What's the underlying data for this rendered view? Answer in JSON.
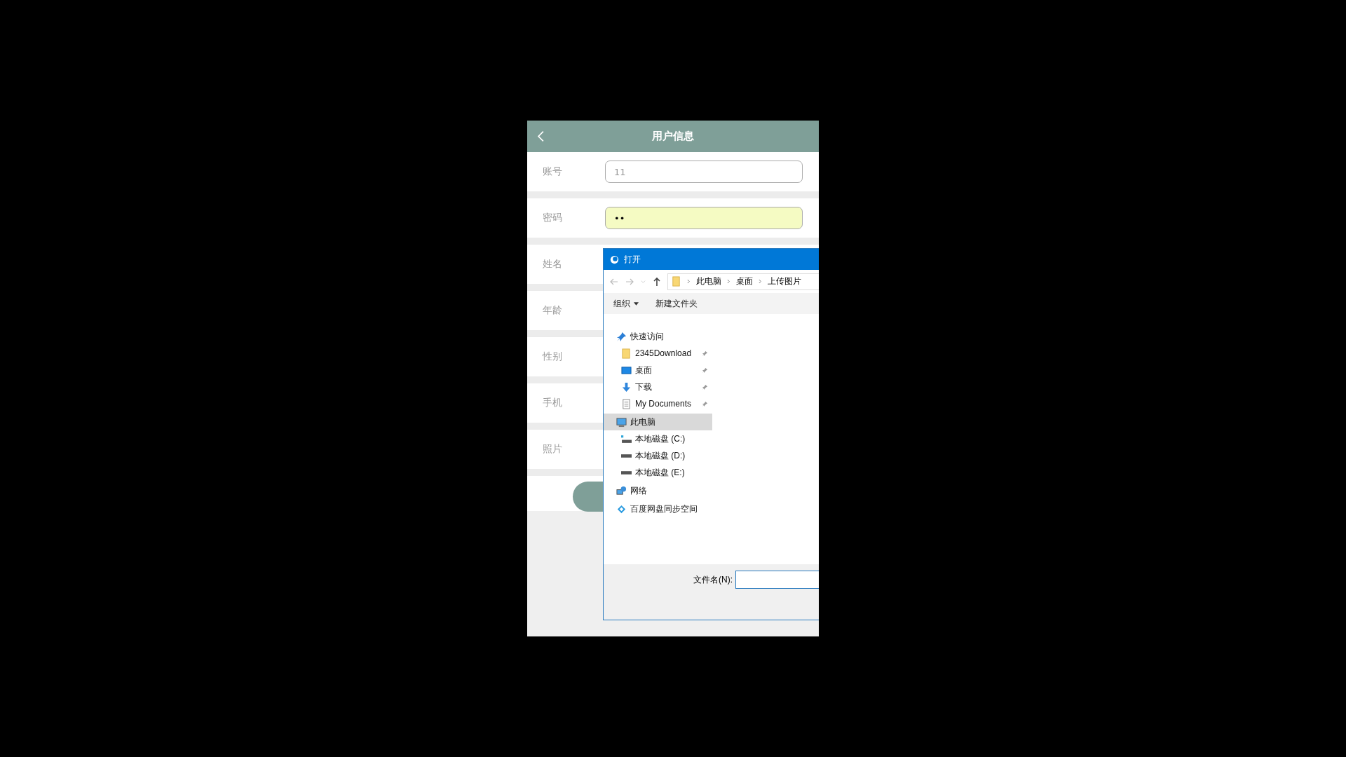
{
  "app": {
    "title": "用户信息",
    "fields": [
      {
        "label": "账号",
        "kind": "input",
        "value": "11",
        "autofilled": false
      },
      {
        "label": "密码",
        "kind": "input",
        "value": "••",
        "autofilled": true
      },
      {
        "label": "姓名",
        "kind": "label"
      },
      {
        "label": "年龄",
        "kind": "label"
      },
      {
        "label": "性别",
        "kind": "label"
      },
      {
        "label": "手机",
        "kind": "label"
      },
      {
        "label": "照片",
        "kind": "label"
      }
    ]
  },
  "dialog": {
    "title": "打开",
    "path": [
      "此电脑",
      "桌面",
      "上传图片"
    ],
    "toolbar": [
      {
        "label": "组织",
        "dropdown": true
      },
      {
        "label": "新建文件夹",
        "dropdown": false
      }
    ],
    "nav": [
      {
        "label": "快速访问",
        "kind": "star",
        "selected": false,
        "children": [
          {
            "label": "2345Download",
            "kind": "folder",
            "pinned": true,
            "selected": false
          },
          {
            "label": "桌面",
            "kind": "desktop",
            "pinned": true,
            "selected": false
          },
          {
            "label": "下载",
            "kind": "download",
            "pinned": true,
            "selected": false
          },
          {
            "label": "My Documents",
            "kind": "document",
            "pinned": true,
            "selected": false
          }
        ]
      },
      {
        "label": "此电脑",
        "kind": "computer",
        "selected": true,
        "children": [
          {
            "label": "本地磁盘 (C:)",
            "kind": "system-drive",
            "pinned": false,
            "selected": false
          },
          {
            "label": "本地磁盘 (D:)",
            "kind": "drive",
            "pinned": false,
            "selected": false
          },
          {
            "label": "本地磁盘 (E:)",
            "kind": "drive",
            "pinned": false,
            "selected": false
          }
        ]
      },
      {
        "label": "网络",
        "kind": "network",
        "selected": false
      },
      {
        "label": "百度网盘同步空间",
        "kind": "sync",
        "selected": false
      }
    ],
    "filename_label": "文件名(N):"
  }
}
